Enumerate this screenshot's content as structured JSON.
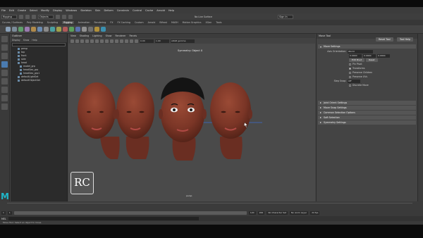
{
  "menubar": {
    "items": [
      "File",
      "Edit",
      "Create",
      "Select",
      "Modify",
      "Display",
      "Windows",
      "Skeleton",
      "Skin",
      "Deform",
      "Constrain",
      "Control",
      "Cache",
      "Arnold",
      "Help"
    ]
  },
  "status": {
    "workspace_dropdown": "Rigging",
    "object_dropdown": "Objects",
    "sign_in": "Sign In",
    "symmetry_label": "No Live Surface"
  },
  "shelf": {
    "tabs": [
      "Curves / Surfaces",
      "Poly Modeling",
      "Sculpting",
      "Rigging",
      "Animation",
      "Rendering",
      "FX",
      "FX Caching",
      "Custom",
      "Arnold",
      "Bifrost",
      "MASH",
      "Motion Graphics",
      "XGen",
      "Tools"
    ],
    "active_tab": "Rigging"
  },
  "outliner": {
    "title": "Outliner",
    "menu": [
      "Display",
      "Show",
      "Help"
    ],
    "items": [
      "persp",
      "top",
      "front",
      "side",
      "head",
      "model_grp",
      "headGeo_grp",
      "headGeo_grp1",
      "defaultLightSet",
      "defaultObjectSet"
    ]
  },
  "viewport": {
    "menu": [
      "View",
      "Shading",
      "Lighting",
      "Show",
      "Renderer",
      "Panels"
    ],
    "camera_label": "Symmetry: Object X",
    "persp_label": "persp",
    "gamma_field": "sRGB gamma",
    "exposure": "0.00",
    "gamma": "1.00"
  },
  "logo": {
    "text": "RC"
  },
  "brand": {
    "text": "M"
  },
  "attr": {
    "title": "Move Tool",
    "reset_label": "Reset Tool",
    "help_label": "Tool Help",
    "section_move": "Move Settings",
    "axis_label": "Axis Orientation:",
    "axis_value": "World",
    "edit_pivot": "Edit Pivot",
    "reset": "Reset",
    "opts": [
      "Pin Pivot",
      "Transforms",
      "Preserve Children",
      "Preserve UVs"
    ],
    "x": "0.0000",
    "y": "0.0000",
    "z": "0.0000",
    "step_label": "Step Snap:",
    "step_value": "Off",
    "discrete": "Discrete Move",
    "sections": [
      "Joint Orient Settings",
      "Move Snap Settings",
      "Common Selection Options",
      "Soft Selection",
      "Symmetry Settings"
    ]
  },
  "timeline": {
    "start": "1",
    "end": "120",
    "range_start": "1",
    "range_end": "120",
    "max": "200",
    "char_set": "No Character Set",
    "anim_layer": "No Anim Layer",
    "fps": "24 fps"
  },
  "cmd": {
    "mel": "MEL"
  },
  "help": {
    "text": "Move Tool: Select an object to move."
  },
  "colors": {
    "skin": "#7a3a2a",
    "hair": "#141414",
    "accent": "#4a7bb0",
    "maya_teal": "#1fb6c9"
  }
}
